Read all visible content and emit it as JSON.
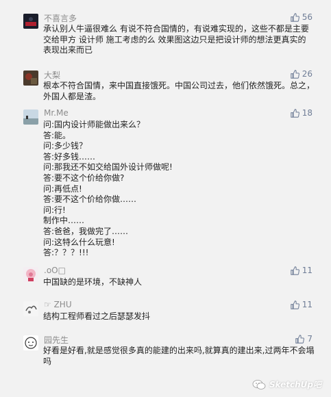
{
  "comments": [
    {
      "name": "不喜言多",
      "likes": "56",
      "lines": [
        "承认别人牛逼很难么  有说不符合国情的，有说难实现的，这些不都是主要",
        "交给甲方 设计师 施工考虑的么  效果图这边只是把设计师的想法更真实的",
        "表现出来而已"
      ]
    },
    {
      "name": "大梨",
      "likes": "26",
      "lines": [
        "根本不符合国情，来中国直接饿死。中国公司过去，他们依然饿死。总之，",
        "外国人都是渣。"
      ]
    },
    {
      "name": "Mr.Me",
      "likes": "18",
      "lines": [
        "问:国内设计师能做出来么？",
        "答:能。",
        "问:多少钱？",
        "答:好多钱……",
        "问:那我还不如交给国外设计师做呢!",
        "答:要不这个价给你做?",
        "问:再低点!",
        "答:要不这个价给你做……",
        "问:行!",
        "制作中……",
        "答:爸爸，我做完了……",
        "问:这特么什么玩意!",
        "答:？？？!!!"
      ]
    },
    {
      "name": ".oO□",
      "likes": "11",
      "lines": [
        "中国缺的是环境，不缺神人"
      ]
    },
    {
      "name": "☞ ZHU",
      "likes": "11",
      "lines": [
        "结构工程师看过之后瑟瑟发抖"
      ]
    },
    {
      "name": "园先生",
      "likes": "7",
      "lines": [
        "好看是好看,就是感觉很多真的能建的出来吗,就算真的建出来,过两年不会塌",
        "吗"
      ]
    }
  ],
  "watermark": "SketchUp吧",
  "icons": {
    "like": "thumbs-up-icon",
    "watermark": "wechat-icon"
  },
  "colors": {
    "background": "#f2f2f2",
    "like": "#6f7d96",
    "name": "#8c8c8c"
  }
}
